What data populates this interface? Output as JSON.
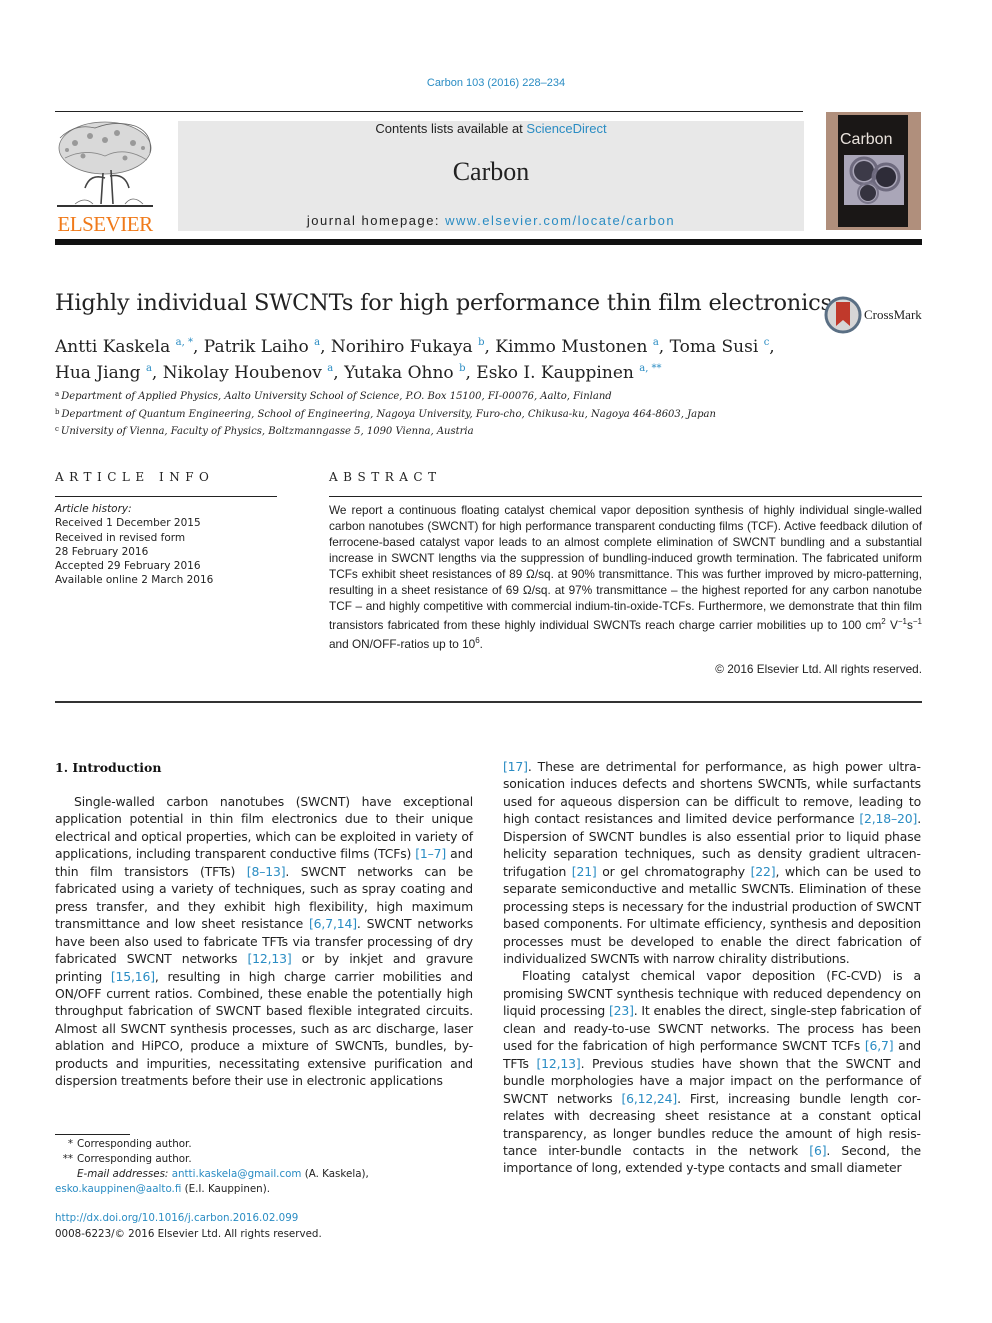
{
  "header": {
    "citation": "Carbon 103 (2016) 228–234",
    "publisher_logo_text": "ELSEVIER",
    "contents_prefix": "Contents lists available at ",
    "contents_link": "ScienceDirect",
    "journal_name": "Carbon",
    "homepage_prefix": "journal homepage: ",
    "homepage_link": "www.elsevier.com/locate/carbon",
    "cover_title": "Carbon"
  },
  "article": {
    "title": "Highly individual SWCNTs for high performance thin film electronics",
    "crossmark_label": "CrossMark",
    "authors_line1": [
      {
        "name": "Antti Kaskela",
        "sup": "a, *",
        "sep": ", "
      },
      {
        "name": "Patrik Laiho",
        "sup": "a",
        "sep": ", "
      },
      {
        "name": "Norihiro Fukaya",
        "sup": "b",
        "sep": ", "
      },
      {
        "name": "Kimmo Mustonen",
        "sup": "a",
        "sep": ", "
      },
      {
        "name": "Toma Susi",
        "sup": "c",
        "sep": ","
      }
    ],
    "authors_line2": [
      {
        "name": "Hua Jiang",
        "sup": "a",
        "sep": ", "
      },
      {
        "name": "Nikolay Houbenov",
        "sup": "a",
        "sep": ", "
      },
      {
        "name": "Yutaka Ohno",
        "sup": "b",
        "sep": ", "
      },
      {
        "name": "Esko I. Kauppinen",
        "sup": "a, **",
        "sep": ""
      }
    ],
    "affiliations": [
      {
        "sup": "a",
        "text": "Department of Applied Physics, Aalto University School of Science, P.O. Box 15100, FI-00076, Aalto, Finland"
      },
      {
        "sup": "b",
        "text": "Department of Quantum Engineering, School of Engineering, Nagoya University, Furo-cho, Chikusa-ku, Nagoya 464-8603, Japan"
      },
      {
        "sup": "c",
        "text": "University of Vienna, Faculty of Physics, Boltzmanngasse 5, 1090 Vienna, Austria"
      }
    ]
  },
  "article_info": {
    "heading": "ARTICLE INFO",
    "history_title": "Article history:",
    "history": [
      "Received 1 December 2015",
      "Received in revised form",
      "28 February 2016",
      "Accepted 29 February 2016",
      "Available online 2 March 2016"
    ]
  },
  "abstract": {
    "heading": "ABSTRACT",
    "text_part1": "We report a continuous floating catalyst chemical vapor deposition synthesis of highly individual single-walled carbon nanotubes (SWCNT) for high performance transparent conducting films (TCF). Active feedback dilution of ferrocene-based catalyst vapor leads to an almost complete elimination of SWCNT bundling and a substantial increase in SWCNT lengths via the suppression of bundling-induced growth termination. The fabricated uniform TCFs exhibit sheet resistances of 89 Ω/sq. at 90% transmittance. This was further improved by micro-patterning, resulting in a sheet resistance of 69 Ω/sq. at 97% trans­mittance – the highest reported for any carbon nanotube TCF – and highly competitive with commercial indium-tin-oxide-TCFs. Furthermore, we demonstrate that thin film transistors fabricated from these highly individual SWCNTs reach charge carrier mobilities up to 100 cm",
    "sup1": "2",
    "text_part2": " V",
    "sup2": "−1",
    "text_part3": "s",
    "sup3": "−1",
    "text_part4": " and ON/OFF-ratios up to 10",
    "sup4": "6",
    "text_part5": ".",
    "copyright": "© 2016 Elsevier Ltd. All rights reserved."
  },
  "body": {
    "section_heading": "1.  Introduction",
    "left_para": [
      {
        "t": "Single-walled carbon nanotubes (SWCNT) have exceptional application potential in thin film electronics due to their unique electrical and optical properties, which can be exploited in variety of applications, including transparent conductive films (TCFs) "
      },
      {
        "ref": "[1–7]"
      },
      {
        "t": " and thin film transistors (TFTs) "
      },
      {
        "ref": "[8–13]"
      },
      {
        "t": ". SWCNT networks can be fabricated using a variety of techniques, such as spray coating and press transfer, and they exhibit high flexibility, high maximum transmittance and low sheet resistance "
      },
      {
        "ref": "[6,7,14]"
      },
      {
        "t": ". SWCNT networks have been also used to fabricate TFTs via transfer processing of dry fabricated SWCNT networks "
      },
      {
        "ref": "[12,13]"
      },
      {
        "t": " or by inkjet and gravure printing "
      },
      {
        "ref": "[15,16]"
      },
      {
        "t": ", resulting in high charge carrier mobilities and ON/OFF current ratios. Combined, these enable the potentially high throughput fabrication of SWCNT based flexible integrated circuits. Almost all SWCNT synthesis processes, such as arc discharge, laser ablation and HiPCO, produce a mixture of SWCNTs, bundles, by-products and impurities, necessitating extensive purification and dispersion treatments before their use in electronic applications"
      }
    ],
    "right_para1": [
      {
        "ref": "[17]"
      },
      {
        "t": ". These are detrimental for performance, as high power ultra­sonication induces defects and shortens SWCNTs, while surfactants used for aqueous dispersion can be difficult to remove, leading to high contact resistances and limited device performance "
      },
      {
        "ref": "[2,18–20]"
      },
      {
        "t": ". Dispersion of SWCNT bundles is also essential prior to liquid phase helicity separation techniques, such as density gradient ultracen­trifugation "
      },
      {
        "ref": "[21]"
      },
      {
        "t": " or gel chromatography "
      },
      {
        "ref": "[22]"
      },
      {
        "t": ", which can be used to separate semiconductive and metallic SWCNTs. Elimination of these processing steps is necessary for the industrial production of SWCNT based components. For ultimate efficiency, synthesis and deposition processes must be developed to enable the direct fabrication of individualized SWCNTs with narrow chirality distributions."
      }
    ],
    "right_para2": [
      {
        "t": "Floating catalyst chemical vapor deposition (FC-CVD) is a promising SWCNT synthesis technique with reduced dependency on liquid processing "
      },
      {
        "ref": "[23]"
      },
      {
        "t": ". It enables the direct, single-step fabri­cation of clean and ready-to-use SWCNT networks. The process has been used for the fabrication of high performance SWCNT TCFs "
      },
      {
        "ref": "[6,7]"
      },
      {
        "t": " and TFTs "
      },
      {
        "ref": "[12,13]"
      },
      {
        "t": ". Previous studies have shown that the SWCNT and bundle morphologies have a major impact on the performance of SWCNT networks "
      },
      {
        "ref": "[6,12,24]"
      },
      {
        "t": ". First, increasing bundle length cor­relates with decreasing sheet resistance at a constant optical transparency, as longer bundles reduce the amount of high resis­tance inter-bundle contacts in the network "
      },
      {
        "ref": "[6]"
      },
      {
        "t": ". Second, the importance of long, extended y-type contacts and small diameter"
      }
    ]
  },
  "footnotes": {
    "star1_mark": "*",
    "star1_text": "Corresponding author.",
    "star2_mark": "**",
    "star2_text": "Corresponding author.",
    "email_label": "E-mail addresses: ",
    "email1": "antti.kaskela@gmail.com",
    "email1_owner": " (A. Kaskela), ",
    "email2": "esko.kauppinen@aalto.fi",
    "email2_owner": " (E.I. Kauppinen)."
  },
  "doi": {
    "link": "http://dx.doi.org/10.1016/j.carbon.2016.02.099",
    "issn_line": "0008-6223/© 2016 Elsevier Ltd. All rights reserved."
  },
  "colors": {
    "link": "#2a8cc3",
    "elsevier_orange": "#f07a1a",
    "masthead_bg": "#e8e8e8"
  }
}
